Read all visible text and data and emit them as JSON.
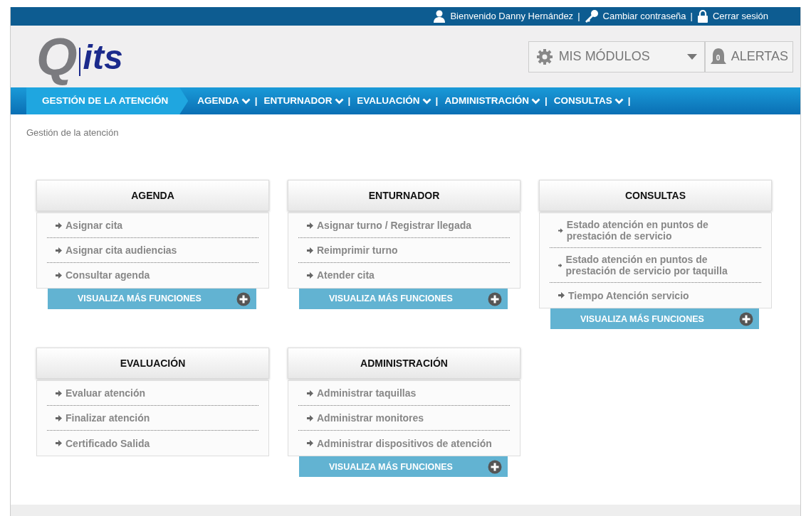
{
  "top_bar": {
    "items": [
      {
        "kind": "user",
        "label": "Bienvenido Danny  Hernández",
        "separator": "|"
      },
      {
        "kind": "key",
        "label": "Cambiar contraseña",
        "separator": "|"
      },
      {
        "kind": "lock",
        "label": "Cerrar sesión"
      }
    ]
  },
  "logo": {
    "letter": "Q",
    "text": "its"
  },
  "modules_select": {
    "label": "MIS MÓDULOS"
  },
  "alerts": {
    "label": "ALERTAS",
    "count": "0"
  },
  "nav": [
    {
      "label": "GESTIÓN DE LA ATENCIÓN",
      "selected": true,
      "has_menu": false
    },
    {
      "label": "AGENDA",
      "selected": false,
      "has_menu": true,
      "separator": "|"
    },
    {
      "label": "ENTURNADOR",
      "selected": false,
      "has_menu": true,
      "separator": "|"
    },
    {
      "label": "EVALUACIÓN",
      "selected": false,
      "has_menu": true,
      "separator": "|"
    },
    {
      "label": "ADMINISTRACIÓN",
      "selected": false,
      "has_menu": true,
      "separator": "|"
    },
    {
      "label": "CONSULTAS",
      "selected": false,
      "has_menu": true,
      "separator": "|"
    }
  ],
  "breadcrumb": "Gestión de la atención",
  "cards": [
    {
      "title": "AGENDA",
      "items": [
        "Asignar cita",
        "Asignar cita audiencias",
        "Consultar agenda"
      ],
      "more_button": "VISUALIZA MÁS FUNCIONES"
    },
    {
      "title": "ENTURNADOR",
      "items": [
        "Asignar turno / Registrar llegada",
        "Reimprimir turno",
        "Atender cita"
      ],
      "more_button": "VISUALIZA MÁS FUNCIONES"
    },
    {
      "title": "CONSULTAS",
      "items": [
        "Estado atención en puntos de prestación de servicio",
        "Estado atención en puntos de prestación de servicio por taquilla",
        "Tiempo Atención servicio"
      ],
      "more_button": "VISUALIZA MÁS FUNCIONES"
    },
    {
      "title": "EVALUACIÓN",
      "items": [
        "Evaluar atención",
        "Finalizar atención",
        "Certificado Salida"
      ]
    },
    {
      "title": "ADMINISTRACIÓN",
      "items": [
        "Administrar taquillas",
        "Administrar monitores",
        "Administrar dispositivos de atención"
      ],
      "more_button": "VISUALIZA MÁS FUNCIONES"
    }
  ]
}
